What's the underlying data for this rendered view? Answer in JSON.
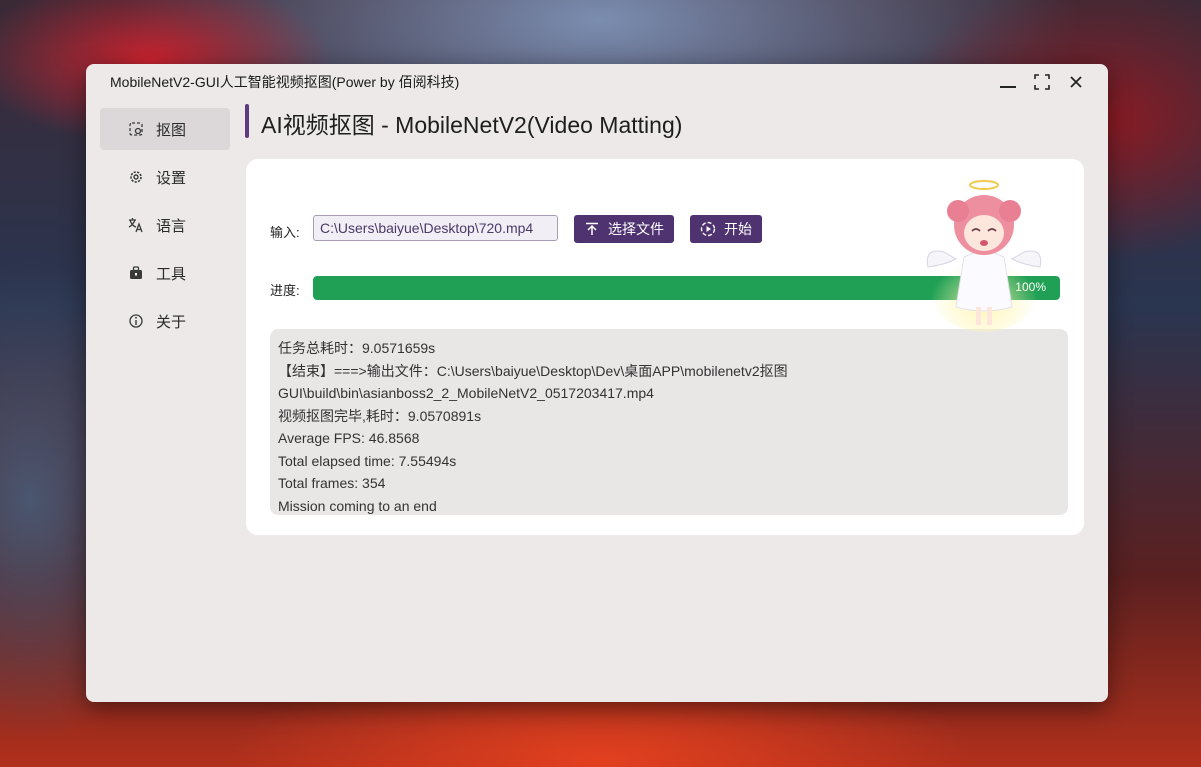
{
  "window": {
    "title": "MobileNetV2-GUI人工智能视频抠图(Power by 佰阅科技)",
    "controls": [
      "minimize-icon",
      "maximize-icon",
      "close-icon"
    ]
  },
  "sidebar": {
    "items": [
      {
        "label": "抠图",
        "icon": "matting-icon",
        "active": true
      },
      {
        "label": "设置",
        "icon": "gear-icon",
        "active": false
      },
      {
        "label": "语言",
        "icon": "translate-icon",
        "active": false
      },
      {
        "label": "工具",
        "icon": "toolbox-icon",
        "active": false
      },
      {
        "label": "关于",
        "icon": "info-icon",
        "active": false
      }
    ]
  },
  "page": {
    "title": "AI视频抠图 - MobileNetV2(Video Matting)"
  },
  "form": {
    "input_label": "输入:",
    "input_value": "C:\\Users\\baiyue\\Desktop\\720.mp4",
    "choose_file_label": "选择文件",
    "start_label": "开始",
    "progress_label": "进度:",
    "progress_value": 1.0,
    "progress_text": "100%"
  },
  "log": {
    "lines": [
      "任务总耗时：9.0571659s",
      "【结束】===>输出文件：C:\\Users\\baiyue\\Desktop\\Dev\\桌面APP\\mobilenetv2抠图",
      "GUI\\build\\bin\\asianboss2_2_MobileNetV2_0517203417.mp4",
      "视频抠图完毕,耗时：9.0570891s",
      "Average FPS: 46.8568",
      "Total elapsed time: 7.55494s",
      "Total frames: 354",
      "Mission coming to an end"
    ]
  },
  "colors": {
    "accent": "#4f3370",
    "progress": "#1fa055",
    "window_bg": "#ece9e8",
    "card_bg": "#ffffff"
  }
}
